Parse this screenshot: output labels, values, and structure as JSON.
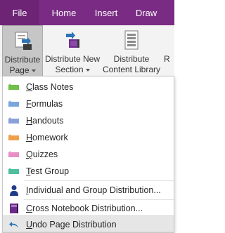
{
  "tabs": [
    {
      "label": "File"
    },
    {
      "label": "Home"
    },
    {
      "label": "Insert"
    },
    {
      "label": "Draw"
    }
  ],
  "ribbon": {
    "distribute_page": {
      "line1": "Distribute",
      "line2": "Page",
      "icon": "distribute-page-icon"
    },
    "distribute_new_section": {
      "line1": "Distribute New",
      "line2": "Section",
      "icon": "distribute-section-icon"
    },
    "distribute_content_library": {
      "line1": "Distribute",
      "line2": "Content Library",
      "icon": "content-library-icon"
    },
    "overflow": {
      "line1": "R"
    }
  },
  "menu": {
    "sections": [
      {
        "pre": "",
        "ul": "C",
        "post": "lass Notes",
        "color": "#6fbf4a"
      },
      {
        "pre": "",
        "ul": "F",
        "post": "ormulas",
        "color": "#7aa8dc"
      },
      {
        "pre": "",
        "ul": "H",
        "post": "andouts",
        "color": "#8aa0d8"
      },
      {
        "pre": "",
        "ul": "H",
        "post": "omework",
        "color": "#f0a04a"
      },
      {
        "pre": "",
        "ul": "Q",
        "post": "uizzes",
        "color": "#e88fc8"
      },
      {
        "pre": "",
        "ul": "T",
        "post": "est Group",
        "color": "#4fbfa0"
      }
    ],
    "individual_group": {
      "pre": "",
      "ul": "I",
      "post": "ndividual and Group Distribution...",
      "icon": "person-icon"
    },
    "cross_notebook": {
      "pre": "",
      "ul": "C",
      "post": "ross Notebook Distribution...",
      "icon": "notebook-icon"
    },
    "undo": {
      "pre": "",
      "ul": "U",
      "post": "ndo Page Distribution",
      "icon": "undo-icon"
    }
  },
  "colors": {
    "tabbar": "#7a2c84",
    "ribbon": "#f3f3f3",
    "hover": "#e6e6e6"
  }
}
